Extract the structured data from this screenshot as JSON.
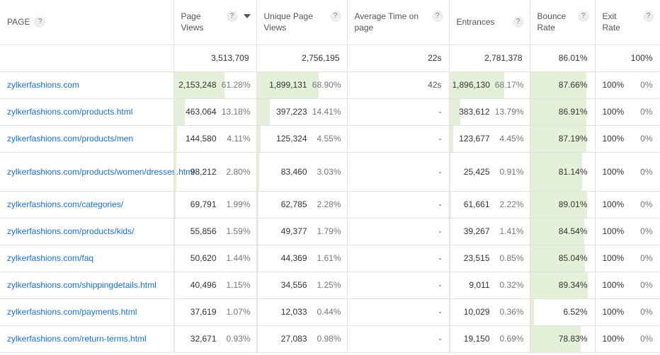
{
  "columns": {
    "page": "PAGE",
    "page_views": "Page Views",
    "unique_page_views": "Unique Page Views",
    "avg_time": "Average Time on page",
    "entrances": "Entrances",
    "bounce_rate": "Bounce Rate",
    "exit_rate": "Exit Rate"
  },
  "help_glyph": "?",
  "totals": {
    "page_views": "3,513,709",
    "unique_page_views": "2,756,195",
    "avg_time": "22s",
    "entrances": "2,781,378",
    "bounce_rate": "86.01%",
    "exit_rate": "100%"
  },
  "rows": [
    {
      "page": "zylkerfashions.com",
      "pv": "2,153,248",
      "pv_pct": "61.28%",
      "pv_frac": 0.6128,
      "upv": "1,899,131",
      "upv_pct": "68.90%",
      "upv_frac": 0.689,
      "avg": "42s",
      "ent": "1,896,130",
      "ent_pct": "68.17%",
      "ent_frac": 0.6817,
      "bounce": "87.66%",
      "bounce_frac": 0.8766,
      "exit": "100%",
      "exit_pct": "0%"
    },
    {
      "page": "zylkerfashions.com/products.html",
      "pv": "463,064",
      "pv_pct": "13.18%",
      "pv_frac": 0.1318,
      "upv": "397,223",
      "upv_pct": "14.41%",
      "upv_frac": 0.1441,
      "avg": "-",
      "ent": "383,612",
      "ent_pct": "13.79%",
      "ent_frac": 0.1379,
      "bounce": "86.91%",
      "bounce_frac": 0.8691,
      "exit": "100%",
      "exit_pct": "0%"
    },
    {
      "page": "zylkerfashions.com/products/men",
      "pv": "144,580",
      "pv_pct": "4.11%",
      "pv_frac": 0.0411,
      "upv": "125,324",
      "upv_pct": "4.55%",
      "upv_frac": 0.0455,
      "avg": "-",
      "ent": "123,677",
      "ent_pct": "4.45%",
      "ent_frac": 0.0445,
      "bounce": "87.19%",
      "bounce_frac": 0.8719,
      "exit": "100%",
      "exit_pct": "0%"
    },
    {
      "page": "zylkerfashions.com/products/women/dresses.html",
      "pv": "98,212",
      "pv_pct": "2.80%",
      "pv_frac": 0.028,
      "upv": "83,460",
      "upv_pct": "3.03%",
      "upv_frac": 0.0303,
      "avg": "-",
      "ent": "25,425",
      "ent_pct": "0.91%",
      "ent_frac": 0.0091,
      "bounce": "81.14%",
      "bounce_frac": 0.8114,
      "exit": "100%",
      "exit_pct": "0%"
    },
    {
      "page": "zylkerfashions.com/categories/",
      "pv": "69,791",
      "pv_pct": "1.99%",
      "pv_frac": 0.0199,
      "upv": "62,785",
      "upv_pct": "2.28%",
      "upv_frac": 0.0228,
      "avg": "-",
      "ent": "61,661",
      "ent_pct": "2.22%",
      "ent_frac": 0.0222,
      "bounce": "89.01%",
      "bounce_frac": 0.8901,
      "exit": "100%",
      "exit_pct": "0%"
    },
    {
      "page": "zylkerfashions.com/products/kids/",
      "pv": "55,856",
      "pv_pct": "1.59%",
      "pv_frac": 0.0159,
      "upv": "49,377",
      "upv_pct": "1.79%",
      "upv_frac": 0.0179,
      "avg": "-",
      "ent": "39,267",
      "ent_pct": "1.41%",
      "ent_frac": 0.0141,
      "bounce": "84.54%",
      "bounce_frac": 0.8454,
      "exit": "100%",
      "exit_pct": "0%"
    },
    {
      "page": "zylkerfashions.com/faq",
      "pv": "50,620",
      "pv_pct": "1.44%",
      "pv_frac": 0.0144,
      "upv": "44,369",
      "upv_pct": "1.61%",
      "upv_frac": 0.0161,
      "avg": "-",
      "ent": "23,515",
      "ent_pct": "0.85%",
      "ent_frac": 0.0085,
      "bounce": "85.04%",
      "bounce_frac": 0.8504,
      "exit": "100%",
      "exit_pct": "0%"
    },
    {
      "page": "zylkerfashions.com/shippingdetails.html",
      "pv": "40,496",
      "pv_pct": "1.15%",
      "pv_frac": 0.0115,
      "upv": "34,556",
      "upv_pct": "1.25%",
      "upv_frac": 0.0125,
      "avg": "-",
      "ent": "9,011",
      "ent_pct": "0.32%",
      "ent_frac": 0.0032,
      "bounce": "89.34%",
      "bounce_frac": 0.8934,
      "exit": "100%",
      "exit_pct": "0%"
    },
    {
      "page": "zylkerfashions.com/payments.html",
      "pv": "37,619",
      "pv_pct": "1.07%",
      "pv_frac": 0.0107,
      "upv": "12,033",
      "upv_pct": "0.44%",
      "upv_frac": 0.0044,
      "avg": "-",
      "ent": "10,029",
      "ent_pct": "0.36%",
      "ent_frac": 0.0036,
      "bounce": "6.52%",
      "bounce_frac": 0.0652,
      "exit": "100%",
      "exit_pct": "0%"
    },
    {
      "page": "zylkerfashions.com/return-terms.html",
      "pv": "32,671",
      "pv_pct": "0.93%",
      "pv_frac": 0.0093,
      "upv": "27,083",
      "upv_pct": "0.98%",
      "upv_frac": 0.0098,
      "avg": "-",
      "ent": "19,150",
      "ent_pct": "0.69%",
      "ent_frac": 0.0069,
      "bounce": "78.83%",
      "bounce_frac": 0.7883,
      "exit": "100%",
      "exit_pct": "0%"
    }
  ],
  "colors": {
    "link": "#1a6fd4",
    "bar_fill": "#e4f1d8",
    "border": "#e2e2e2"
  },
  "icons": {
    "help": "question-circle-icon",
    "sort": "sort-descending-icon"
  }
}
